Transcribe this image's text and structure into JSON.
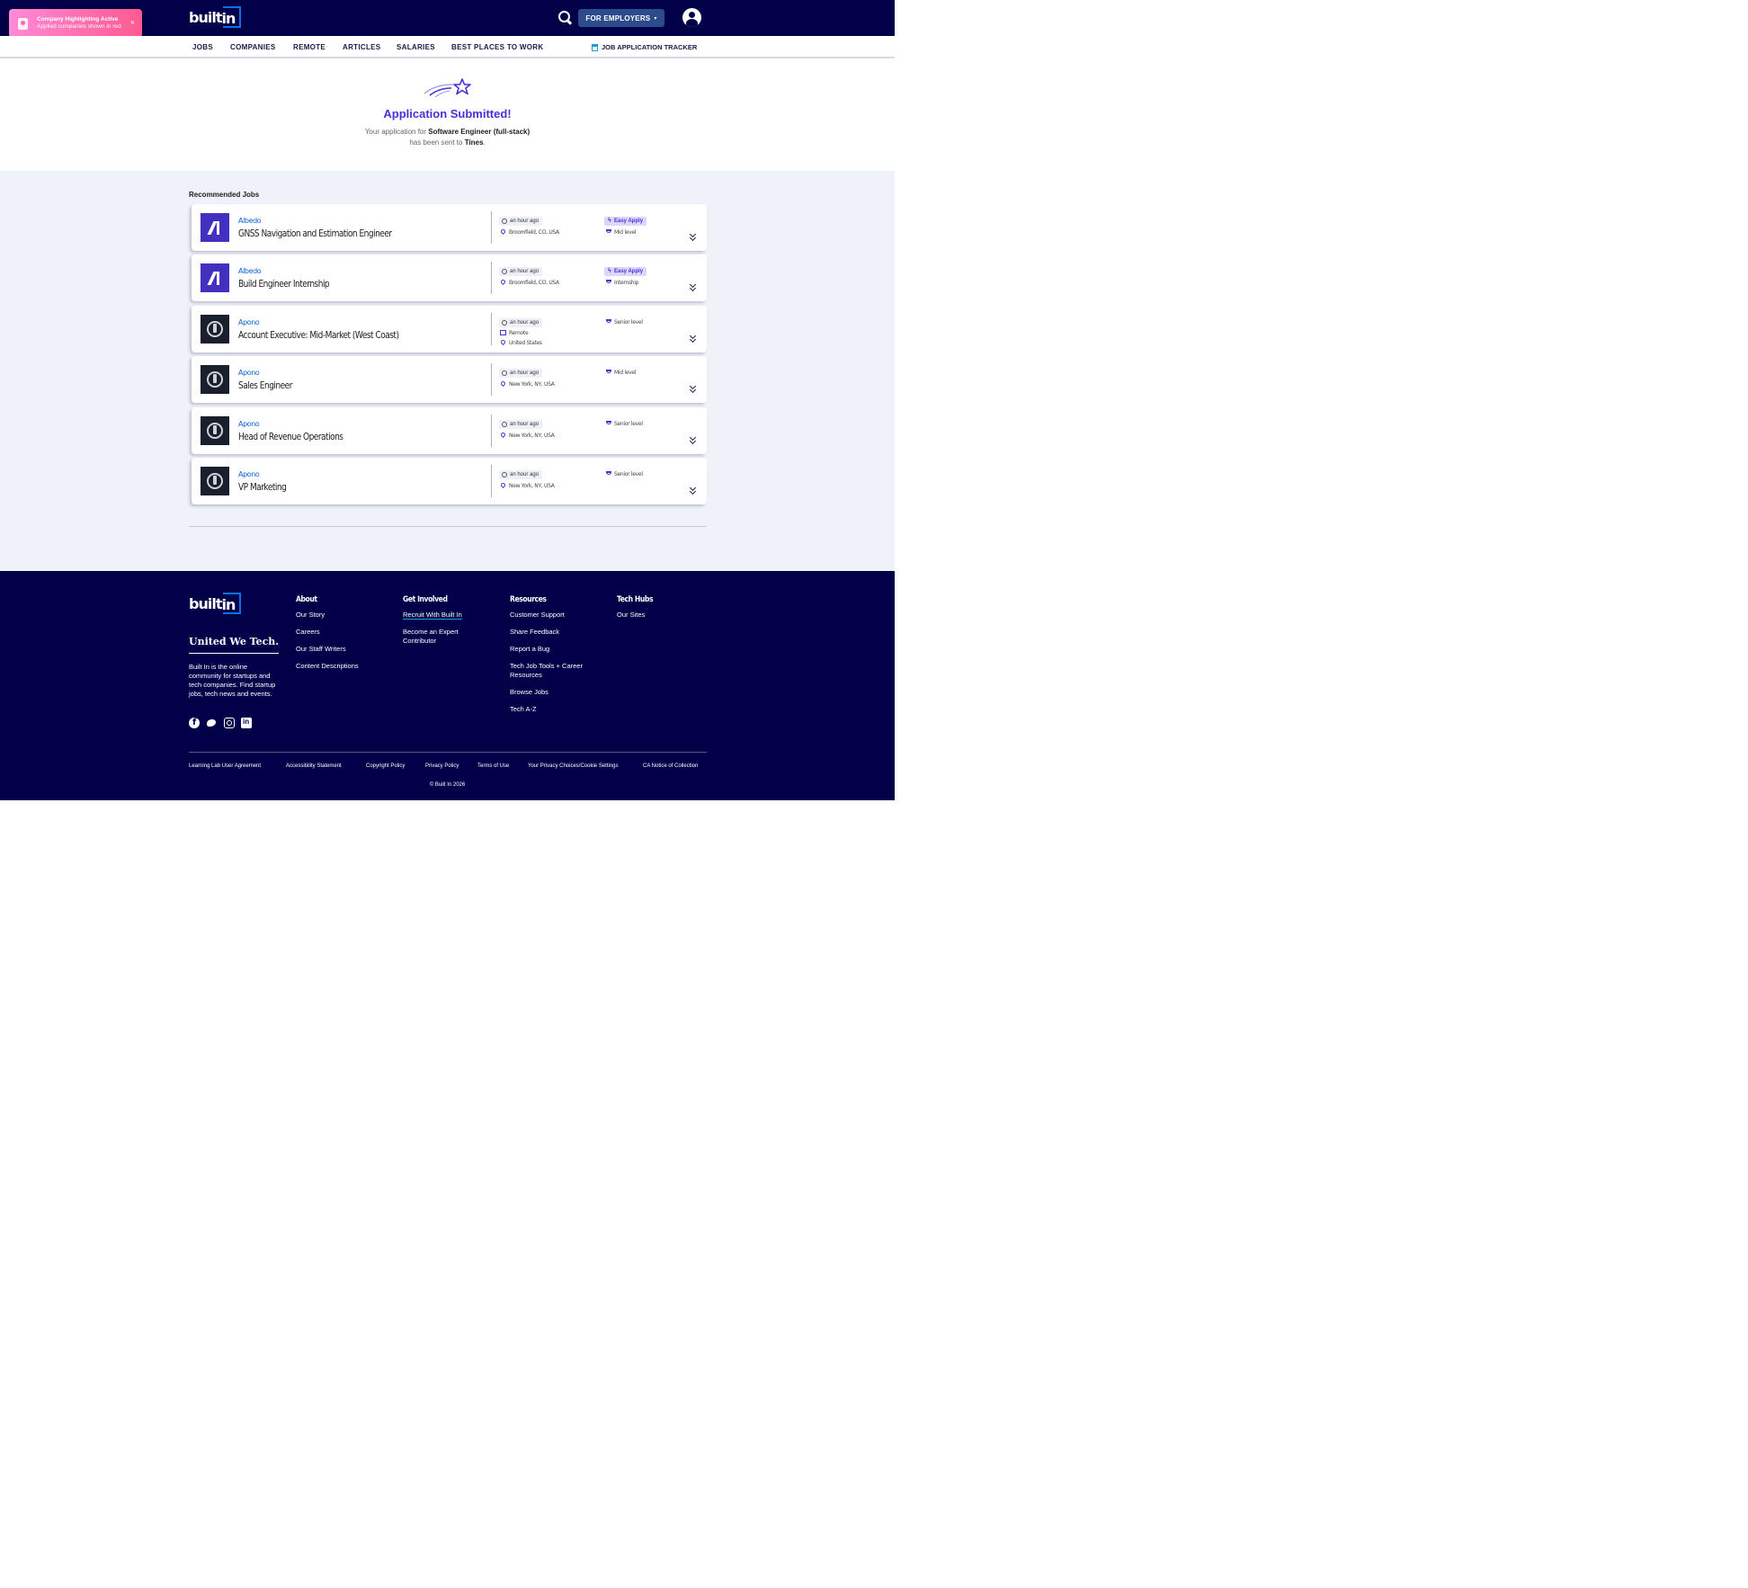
{
  "toast": {
    "title": "Company Highlighting Active",
    "subtitle": "Applied companies shown in red",
    "close": "×"
  },
  "header": {
    "logo_text": "built",
    "logo_suffix": "in",
    "employers_label": "FOR EMPLOYERS",
    "employers_caret": "▾"
  },
  "subnav": {
    "items": [
      "JOBS",
      "COMPANIES",
      "REMOTE",
      "ARTICLES",
      "SALARIES",
      "BEST PLACES TO WORK"
    ],
    "tracker": "JOB APPLICATION TRACKER"
  },
  "confirmation": {
    "title": "Application Submitted!",
    "line1_prefix": "Your application for ",
    "job": "Software Engineer (full-stack)",
    "line2_prefix": "has been sent to ",
    "company": "Tines",
    "line2_suffix": "."
  },
  "recommended": {
    "title": "Recommended Jobs",
    "jobs": [
      {
        "company": "Albedo",
        "title": "GNSS Navigation and Estimation Engineer",
        "posted": "an hour ago",
        "location": "Broomfield, CO, USA",
        "easy_apply": "Easy Apply",
        "level": "Mid level"
      },
      {
        "company": "Albedo",
        "title": "Build Engineer Internship",
        "posted": "an hour ago",
        "location": "Broomfield, CO, USA",
        "easy_apply": "Easy Apply",
        "level": "Internship"
      },
      {
        "company": "Apono",
        "title": "Account Executive: Mid-Market (West Coast)",
        "posted": "an hour ago",
        "remote": "Remote",
        "location": "United States",
        "level": "Senior level"
      },
      {
        "company": "Apono",
        "title": "Sales Engineer",
        "posted": "an hour ago",
        "location": "New York, NY, USA",
        "level": "Mid level"
      },
      {
        "company": "Apono",
        "title": "Head of Revenue Operations",
        "posted": "an hour ago",
        "location": "New York, NY, USA",
        "level": "Senior level"
      },
      {
        "company": "Apono",
        "title": "VP Marketing",
        "posted": "an hour ago",
        "location": "New York, NY, USA",
        "level": "Senior level"
      }
    ]
  },
  "footer": {
    "logo_text": "built",
    "logo_suffix": "in",
    "tagline": "United We Tech.",
    "about": "Built In is the online community for startups and tech companies. Find startup jobs, tech news and events.",
    "columns": {
      "about": {
        "head": "About",
        "links": [
          "Our Story",
          "Careers",
          "Our Staff Writers",
          "Content Descriptions"
        ]
      },
      "involved": {
        "head": "Get Involved",
        "links": [
          "Recruit With Built In",
          "Become an Expert Contributor"
        ]
      },
      "resources": {
        "head": "Resources",
        "links": [
          "Customer Support",
          "Share Feedback",
          "Report a Bug",
          "Tech Job Tools + Career Resources",
          "Browse Jobs",
          "Tech A-Z"
        ]
      },
      "hubs": {
        "head": "Tech Hubs",
        "links": [
          "Our Sites"
        ]
      }
    },
    "legal": [
      "Learning Lab User Agreement",
      "Accessibility Statement",
      "Copyright Policy",
      "Privacy Policy",
      "Terms of Use",
      "Your Privacy Choices/Cookie Settings",
      "CA Notice of Collection"
    ],
    "copyright": "© Built In 2026"
  },
  "colors": {
    "navy": "#010048",
    "accent": "#4a30d4",
    "link": "#0f62d6",
    "section_bg": "#f0f2fa"
  }
}
